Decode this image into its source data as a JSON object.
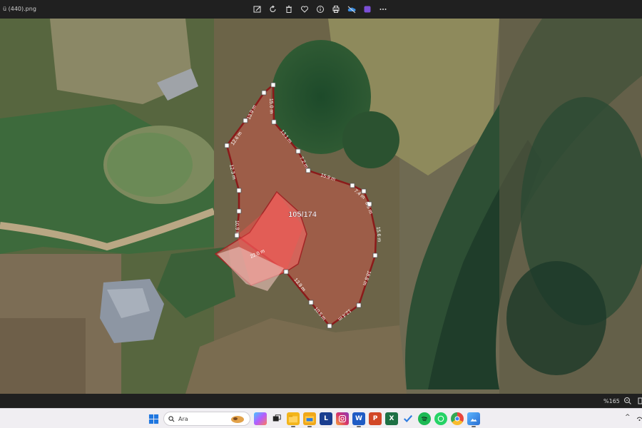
{
  "window": {
    "file_name": "ü (440).png"
  },
  "toolbar": {
    "items": [
      {
        "icon": "edit-image-icon"
      },
      {
        "icon": "rotate-icon"
      },
      {
        "icon": "delete-icon"
      },
      {
        "icon": "favorite-heart-icon"
      },
      {
        "icon": "info-icon"
      },
      {
        "icon": "print-icon"
      },
      {
        "icon": "onedrive-icon"
      },
      {
        "icon": "clipchamp-icon"
      },
      {
        "icon": "more-options-icon"
      }
    ]
  },
  "image": {
    "parcel_label": "105/174",
    "parcel_fill": "#e0554a",
    "building_fill": "#ff5a5a",
    "boundary_color": "#8b1a1a",
    "edge_lengths": [
      "12.6 m",
      "13.9 m",
      "15.0 m",
      "13.1 m",
      "12.3 m",
      "7.2 m",
      "15.9 m",
      "7.4 m",
      "8.5 m",
      "15.6 m",
      "18.8 m",
      "12.4 m",
      "10.5 m",
      "13.9 m",
      "22.0 m",
      "10.9 m"
    ]
  },
  "statusbar": {
    "zoom": "%165"
  },
  "taskbar": {
    "search_placeholder": "Ara",
    "apps": [
      {
        "name": "copilot",
        "color": "#6a5cff",
        "glyph": ""
      },
      {
        "name": "task-view",
        "color": "#2b2b2b",
        "glyph": ""
      },
      {
        "name": "file-explorer",
        "color": "#f3b51b",
        "glyph": ""
      },
      {
        "name": "explorer-folder",
        "color": "#f0a81a",
        "glyph": ""
      },
      {
        "name": "l-app",
        "color": "#1a3d8f",
        "glyph": "L"
      },
      {
        "name": "instagram",
        "color": "#d6336c",
        "glyph": ""
      },
      {
        "name": "word",
        "color": "#1f5bc4",
        "glyph": "W"
      },
      {
        "name": "powerpoint",
        "color": "#d24726",
        "glyph": "P"
      },
      {
        "name": "excel",
        "color": "#1d7044",
        "glyph": "X"
      },
      {
        "name": "todo",
        "color": "#2f7de1",
        "glyph": ""
      },
      {
        "name": "spotify",
        "color": "#1db954",
        "glyph": ""
      },
      {
        "name": "whatsapp",
        "color": "#25d366",
        "glyph": ""
      },
      {
        "name": "chrome",
        "color": "#e8453c",
        "glyph": ""
      },
      {
        "name": "photos",
        "color": "#3a86d8",
        "glyph": ""
      }
    ],
    "tray_chevron": "^"
  }
}
